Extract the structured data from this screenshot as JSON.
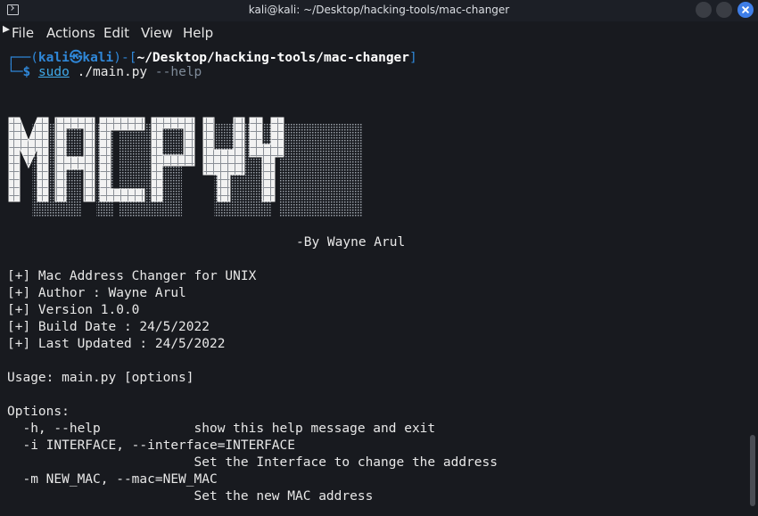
{
  "window": {
    "title": "kali@kali: ~/Desktop/hacking-tools/mac-changer"
  },
  "menu": [
    "File",
    "Actions",
    "Edit",
    "View",
    "Help"
  ],
  "prompt": {
    "open": "┌──(",
    "user": "kali",
    "at": "㉿",
    "host": "kali",
    "mid": ")-[",
    "path": "~/Desktop/hacking-tools/mac-changer",
    "close": "]",
    "corner2": "└─",
    "dollar": "$",
    "sudo": "sudo",
    "command": "./main.py",
    "arg": "--help"
  },
  "banner": {
    "text": "MACPY",
    "byline": "-By Wayne Arul"
  },
  "info": [
    "[+] Mac Address Changer for UNIX",
    "[+] Author : Wayne Arul",
    "[+] Version 1.0.0",
    "[+] Build Date : 24/5/2022",
    "[+] Last Updated : 24/5/2022"
  ],
  "usage": "Usage: main.py [options]",
  "options_header": "Options:",
  "options": [
    "  -h, --help            show this help message and exit",
    "  -i INTERFACE, --interface=INTERFACE",
    "                        Set the Interface to change the address",
    "  -m NEW_MAC, --mac=NEW_MAC",
    "                        Set the new MAC address"
  ],
  "colors": {
    "background": "#181a1f",
    "prompt_blue": "#2f87d8",
    "close_button": "#3f7ee8"
  }
}
